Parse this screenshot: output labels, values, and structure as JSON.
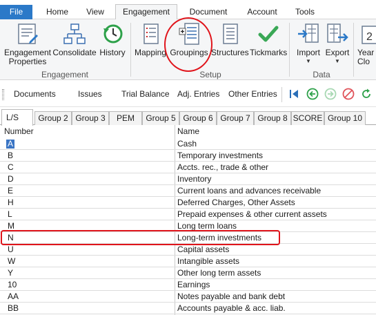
{
  "menu": {
    "tabs": [
      "File",
      "Home",
      "View",
      "Engagement",
      "Document",
      "Account",
      "Tools"
    ],
    "active": "Engagement"
  },
  "ribbon": {
    "engagement_group": {
      "label": "Engagement",
      "buttons": [
        {
          "line1": "Engagement",
          "line2": "Properties",
          "icon": "engagement-properties-icon"
        },
        {
          "line1": "Consolidate",
          "line2": "",
          "icon": "consolidate-icon"
        },
        {
          "line1": "History",
          "line2": "",
          "icon": "history-icon"
        }
      ]
    },
    "setup_group": {
      "label": "Setup",
      "buttons": [
        {
          "line1": "Mapping",
          "icon": "mapping-icon"
        },
        {
          "line1": "Groupings",
          "icon": "groupings-icon"
        },
        {
          "line1": "Structures",
          "icon": "structures-icon"
        },
        {
          "line1": "Tickmarks",
          "icon": "tickmarks-icon"
        }
      ]
    },
    "data_group": {
      "label": "Data",
      "buttons": [
        {
          "line1": "Import",
          "icon": "import-icon"
        },
        {
          "line1": "Export",
          "icon": "export-icon"
        }
      ]
    },
    "partial_button": {
      "line1": "Year",
      "line2": "Clo",
      "icon": "calendar-icon"
    }
  },
  "toolbar": {
    "items": [
      "Documents",
      "Issues",
      "Trial Balance",
      "Adj. Entries",
      "Other Entries"
    ],
    "nav_icons": [
      "jump-icon",
      "back-icon",
      "forward-icon",
      "stop-icon",
      "refresh-icon"
    ]
  },
  "sheet_tabs": {
    "tabs": [
      "L/S",
      "Group 2",
      "Group 3",
      "PEM",
      "Group 5",
      "Group 6",
      "Group 7",
      "Group 8",
      "SCORE",
      "Group 10"
    ],
    "active": "L/S"
  },
  "grid": {
    "columns": [
      "Number",
      "Name"
    ],
    "rows": [
      {
        "number": "A",
        "name": "Cash"
      },
      {
        "number": "B",
        "name": "Temporary investments"
      },
      {
        "number": "C",
        "name": "Accts. rec., trade & other"
      },
      {
        "number": "D",
        "name": "Inventory"
      },
      {
        "number": "E",
        "name": "Current loans and advances receivable"
      },
      {
        "number": "H",
        "name": "Deferred Charges, Other Assets"
      },
      {
        "number": "L",
        "name": "Prepaid expenses & other current assets"
      },
      {
        "number": "M",
        "name": "Long term loans"
      },
      {
        "number": "N",
        "name": "Long-term investments"
      },
      {
        "number": "U",
        "name": "Capital assets"
      },
      {
        "number": "W",
        "name": "Intangible assets"
      },
      {
        "number": "Y",
        "name": "Other long term assets"
      },
      {
        "number": "10",
        "name": "Earnings"
      },
      {
        "number": "AA",
        "name": "Notes payable and bank debt"
      },
      {
        "number": "BB",
        "name": "Accounts payable & acc. liab."
      }
    ],
    "selected_number": "A",
    "highlighted_number": "N"
  },
  "colors": {
    "file_tab": "#2b79c8",
    "selection": "#3a75c4",
    "annotation": "#e0141b"
  }
}
